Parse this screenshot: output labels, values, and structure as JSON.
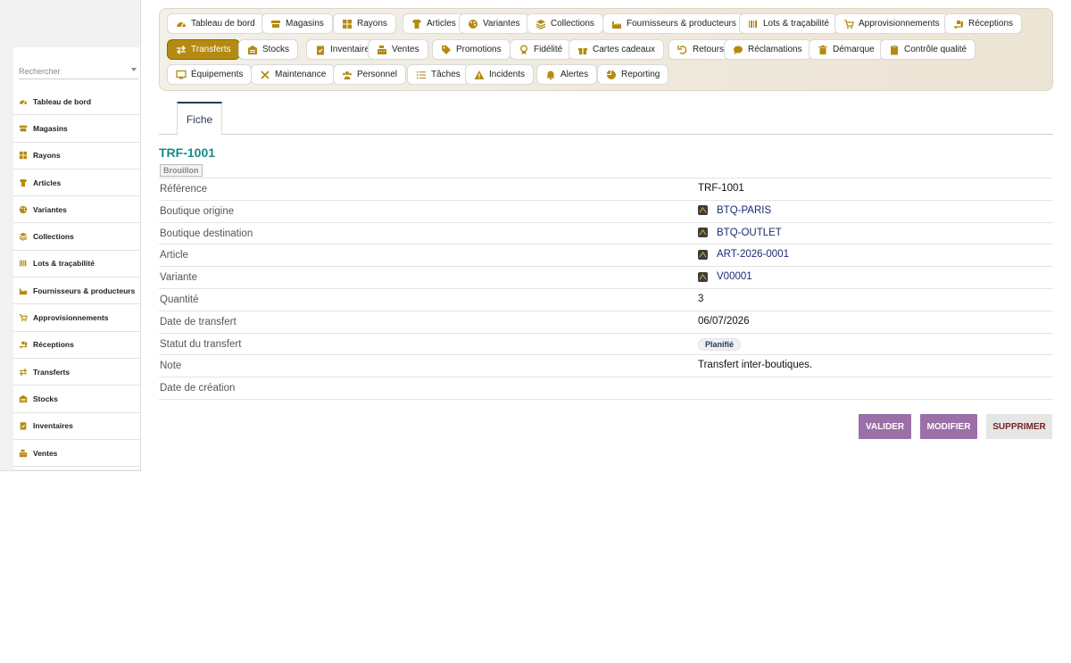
{
  "sidebar": {
    "search_placeholder": "Rechercher",
    "items": [
      {
        "label": "Tableau de bord",
        "icon": "dashboard-icon"
      },
      {
        "label": "Magasins",
        "icon": "store-icon"
      },
      {
        "label": "Rayons",
        "icon": "grid-icon"
      },
      {
        "label": "Articles",
        "icon": "shirt-icon"
      },
      {
        "label": "Variantes",
        "icon": "palette-icon"
      },
      {
        "label": "Collections",
        "icon": "layers-icon"
      },
      {
        "label": "Lots & traçabilité",
        "icon": "barcode-icon"
      },
      {
        "label": "Fournisseurs & producteurs",
        "icon": "industry-icon"
      },
      {
        "label": "Approvisionnements",
        "icon": "cart-icon"
      },
      {
        "label": "Réceptions",
        "icon": "truck-loading-icon"
      },
      {
        "label": "Transferts",
        "icon": "exchange-icon"
      },
      {
        "label": "Stocks",
        "icon": "warehouse-icon"
      },
      {
        "label": "Inventaires",
        "icon": "clipboard-check-icon"
      },
      {
        "label": "Ventes",
        "icon": "cash-register-icon"
      }
    ]
  },
  "nav": {
    "rows": [
      [
        {
          "label": "Tableau de bord",
          "icon": "dashboard-icon"
        },
        {
          "label": "Magasins",
          "icon": "store-icon"
        },
        {
          "label": "Rayons",
          "icon": "grid-icon"
        },
        {
          "label": "Articles",
          "icon": "shirt-icon"
        },
        {
          "label": "Variantes",
          "icon": "palette-icon"
        },
        {
          "label": "Collections",
          "icon": "layers-icon"
        },
        {
          "label": "Fournisseurs & producteurs",
          "icon": "industry-icon"
        },
        {
          "label": "Lots & traçabilité",
          "icon": "barcode-icon"
        },
        {
          "label": "Approvisionnements",
          "icon": "cart-icon"
        },
        {
          "label": "Réceptions",
          "icon": "truck-loading-icon"
        }
      ],
      [
        {
          "label": "Transferts",
          "icon": "exchange-icon",
          "active": true
        },
        {
          "label": "Stocks",
          "icon": "warehouse-icon"
        },
        {
          "label": "Inventaires",
          "icon": "clipboard-check-icon"
        },
        {
          "label": "Ventes",
          "icon": "cash-register-icon"
        },
        {
          "label": "Promotions",
          "icon": "tags-icon"
        },
        {
          "label": "Fidélité",
          "icon": "award-icon"
        },
        {
          "label": "Cartes cadeaux",
          "icon": "gift-icon"
        },
        {
          "label": "Retours",
          "icon": "undo-icon"
        },
        {
          "label": "Réclamations",
          "icon": "comment-icon"
        },
        {
          "label": "Démarque",
          "icon": "trash-icon"
        },
        {
          "label": "Contrôle qualité",
          "icon": "clipboard-icon"
        }
      ],
      [
        {
          "label": "Équipements",
          "icon": "desktop-icon"
        },
        {
          "label": "Maintenance",
          "icon": "tools-icon"
        },
        {
          "label": "Personnel",
          "icon": "users-icon"
        },
        {
          "label": "Tâches",
          "icon": "tasks-icon"
        },
        {
          "label": "Incidents",
          "icon": "warning-icon"
        },
        {
          "label": "Alertes",
          "icon": "bell-icon"
        },
        {
          "label": "Reporting",
          "icon": "pie-chart-icon"
        }
      ]
    ]
  },
  "tabs": [
    {
      "label": "Fiche"
    }
  ],
  "record": {
    "title": "TRF-1001",
    "state": "Brouillon",
    "fields": [
      {
        "label": "Référence",
        "value": "TRF-1001",
        "kind": "text"
      },
      {
        "label": "Boutique origine",
        "value": "BTQ-PARIS",
        "kind": "link"
      },
      {
        "label": "Boutique destination",
        "value": "BTQ-OUTLET",
        "kind": "link"
      },
      {
        "label": "Article",
        "value": "ART-2026-0001",
        "kind": "link"
      },
      {
        "label": "Variante",
        "value": "V00001",
        "kind": "link"
      },
      {
        "label": "Quantité",
        "value": "3",
        "kind": "text"
      },
      {
        "label": "Date de transfert",
        "value": "06/07/2026",
        "kind": "text"
      },
      {
        "label": "Statut du transfert",
        "value": "Planifié",
        "kind": "status"
      },
      {
        "label": "Note",
        "value": "Transfert inter-boutiques.",
        "kind": "text"
      },
      {
        "label": "Date de création",
        "value": "",
        "kind": "text"
      }
    ]
  },
  "actions": {
    "validate": "VALIDER",
    "edit": "MODIFIER",
    "delete": "SUPPRIMER"
  },
  "colors": {
    "accent": "#b58a12",
    "title": "#1b8a8a",
    "action": "#9b6fa8",
    "link": "#1a2a77"
  }
}
